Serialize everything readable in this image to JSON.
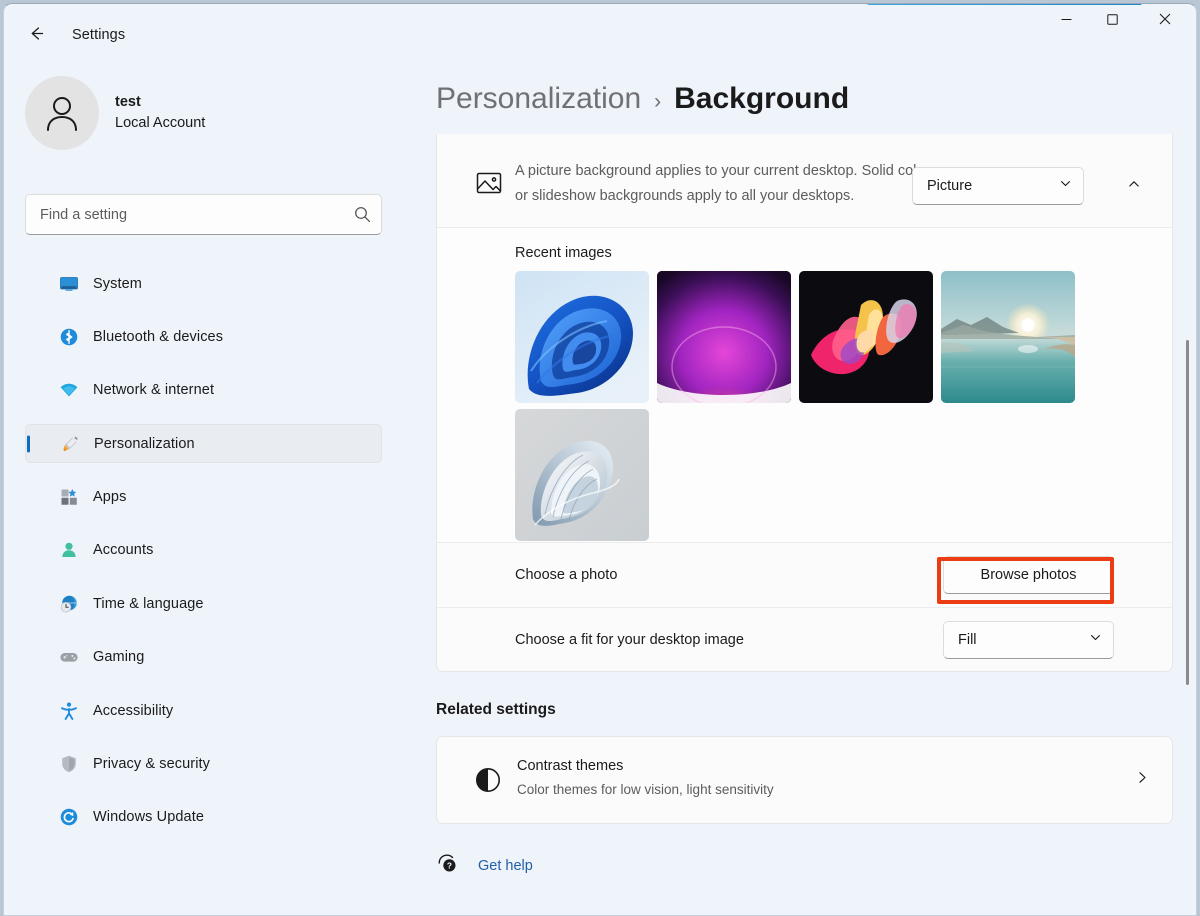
{
  "window": {
    "app_title": "Settings",
    "back_icon": "arrow-left-icon",
    "controls": {
      "minimize": "minimize-icon",
      "maximize": "maximize-icon",
      "close": "close-icon"
    },
    "accent_color": "#2b88c8"
  },
  "sidebar": {
    "account": {
      "name": "test",
      "subtitle": "Local Account",
      "avatar_icon": "person-avatar-icon"
    },
    "search": {
      "placeholder": "Find a setting",
      "value": "",
      "icon": "search-icon"
    },
    "items": [
      {
        "label": "System",
        "icon": "monitor-icon",
        "selected": false
      },
      {
        "label": "Bluetooth & devices",
        "icon": "bluetooth-icon",
        "selected": false
      },
      {
        "label": "Network & internet",
        "icon": "wifi-icon",
        "selected": false
      },
      {
        "label": "Personalization",
        "icon": "paintbrush-icon",
        "selected": true
      },
      {
        "label": "Apps",
        "icon": "apps-grid-icon",
        "selected": false
      },
      {
        "label": "Accounts",
        "icon": "person-icon",
        "selected": false
      },
      {
        "label": "Time & language",
        "icon": "clock-globe-icon",
        "selected": false
      },
      {
        "label": "Gaming",
        "icon": "gamepad-icon",
        "selected": false
      },
      {
        "label": "Accessibility",
        "icon": "accessibility-icon",
        "selected": false
      },
      {
        "label": "Privacy & security",
        "icon": "shield-icon",
        "selected": false
      },
      {
        "label": "Windows Update",
        "icon": "update-refresh-icon",
        "selected": false
      }
    ],
    "selected_accent": "#0f6cbd"
  },
  "main": {
    "breadcrumb": {
      "parent": "Personalization",
      "separator": "›",
      "current": "Background"
    },
    "background_card": {
      "icon": "image-picture-icon",
      "description": "A picture background applies to your current desktop. Solid color or slideshow backgrounds apply to all your desktops.",
      "mode_select": {
        "value": "Picture",
        "chevron_icon": "chevron-down-icon"
      },
      "collapse_icon": "chevron-up-icon",
      "recent_images": {
        "title": "Recent images",
        "thumbnails": [
          {
            "name": "windows-bloom-blue",
            "selected": true
          },
          {
            "name": "purple-orb-glow",
            "selected": false
          },
          {
            "name": "colorful-abstract-dark",
            "selected": false
          },
          {
            "name": "lake-sunrise-landscape",
            "selected": false
          },
          {
            "name": "white-paper-flower",
            "selected": false
          }
        ]
      },
      "choose_photo": {
        "label": "Choose a photo",
        "button_label": "Browse photos",
        "highlighted": true,
        "highlight_color": "#eb3c13"
      },
      "choose_fit": {
        "label": "Choose a fit for your desktop image",
        "value": "Fill",
        "chevron_icon": "chevron-down-icon"
      }
    },
    "related_settings": {
      "title": "Related settings",
      "items": [
        {
          "title": "Contrast themes",
          "subtitle": "Color themes for low vision, light sensitivity",
          "icon": "contrast-circle-icon",
          "chevron_icon": "chevron-right-icon"
        }
      ]
    },
    "get_help": {
      "label": "Get help",
      "icon": "help-question-icon"
    }
  }
}
